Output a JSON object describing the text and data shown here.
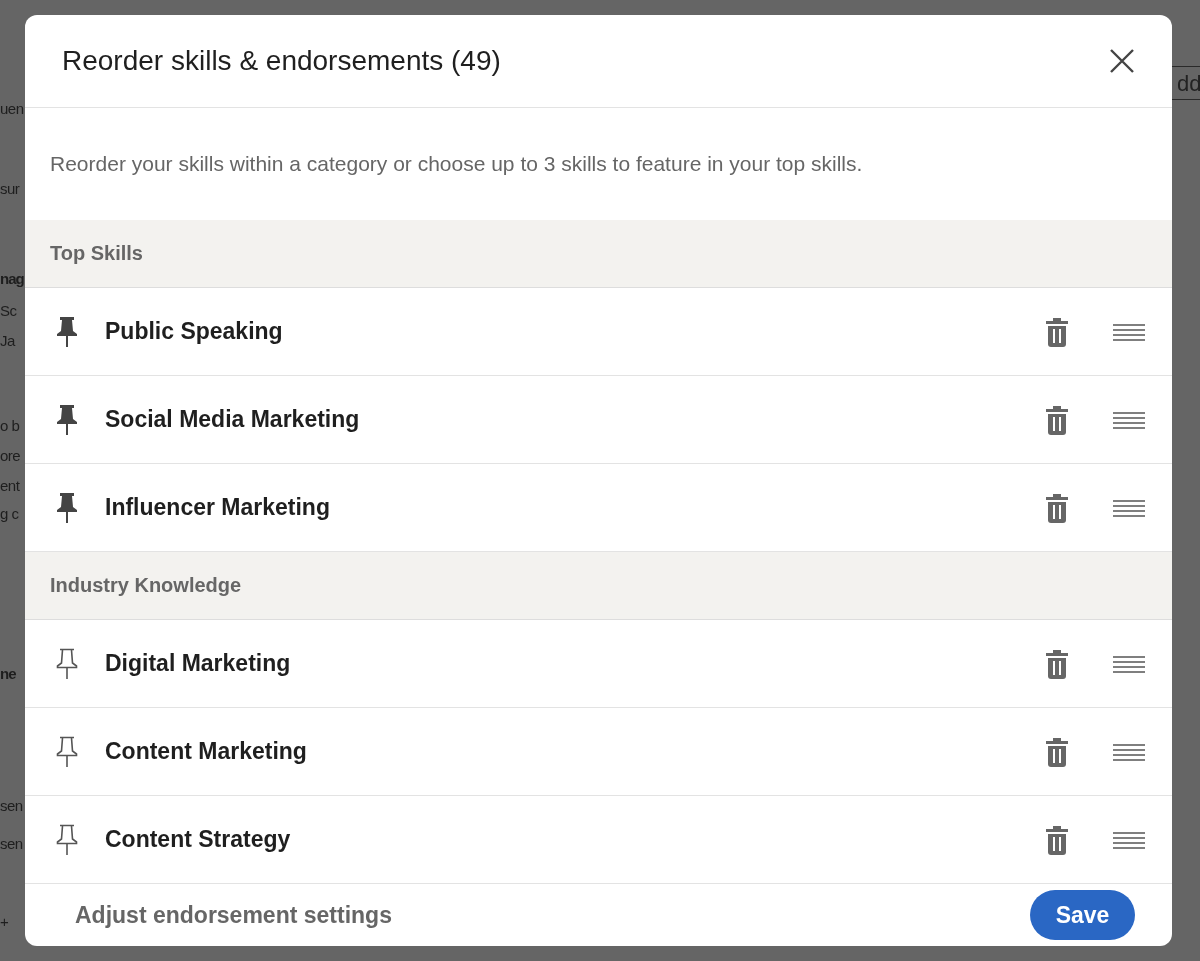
{
  "background_page": {
    "fragments": [
      {
        "text": "uen",
        "bold": false
      },
      {
        "text": "sur",
        "bold": false
      },
      {
        "text": "nag",
        "bold": true
      },
      {
        "text": "Sc",
        "bold": false
      },
      {
        "text": "Ja",
        "bold": false
      },
      {
        "text": "o b",
        "bold": false
      },
      {
        "text": "ore",
        "bold": false
      },
      {
        "text": "ent",
        "bold": false
      },
      {
        "text": "g c",
        "bold": false
      },
      {
        "text": "ne",
        "bold": true
      },
      {
        "text": "sen",
        "bold": false
      },
      {
        "text": "sen",
        "bold": false
      },
      {
        "text": "+",
        "bold": false
      }
    ],
    "right_button": "dd"
  },
  "dialog": {
    "title": "Reorder skills & endorsements (49)",
    "description": "Reorder your skills within a category or choose up to 3 skills to feature in your top skills.",
    "sections": [
      {
        "heading": "Top Skills",
        "skills": [
          {
            "name": "Public Speaking",
            "pinned": true
          },
          {
            "name": "Social Media Marketing",
            "pinned": true
          },
          {
            "name": "Influencer Marketing",
            "pinned": true
          }
        ]
      },
      {
        "heading": "Industry Knowledge",
        "skills": [
          {
            "name": "Digital Marketing",
            "pinned": false
          },
          {
            "name": "Content Marketing",
            "pinned": false
          },
          {
            "name": "Content Strategy",
            "pinned": false
          }
        ]
      }
    ],
    "footer_link": "Adjust endorsement settings",
    "save_button": "Save"
  }
}
